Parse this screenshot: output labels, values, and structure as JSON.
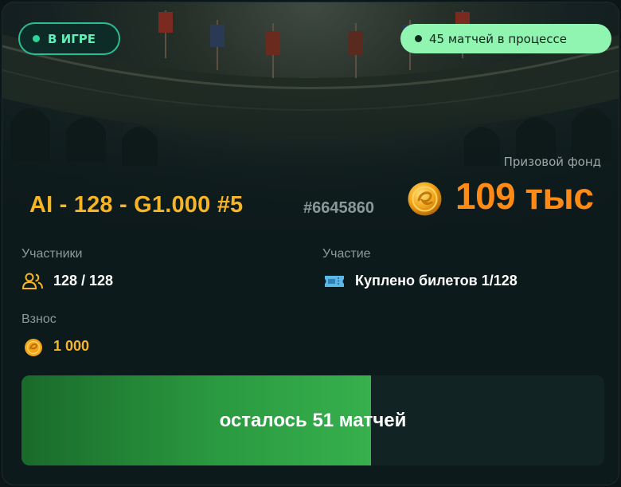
{
  "status": {
    "label": "В ИГРЕ"
  },
  "matches_badge": {
    "label": "45 матчей в процессе"
  },
  "tournament": {
    "title": "AI - 128 - G1.000 #5",
    "id": "#6645860"
  },
  "prize": {
    "label": "Призовой фонд",
    "value": "109 тыс"
  },
  "participants": {
    "label": "Участники",
    "value": "128 / 128"
  },
  "participation": {
    "label": "Участие",
    "value": "Куплено билетов 1/128"
  },
  "fee": {
    "label": "Взнос",
    "value": "1 000"
  },
  "progress": {
    "label": "осталось 51 матчей",
    "fraction": 0.6
  },
  "colors": {
    "accent_green": "#2bbd8f",
    "badge_green": "#8ff5b1",
    "gold": "#f5b526",
    "prize_orange": "#ff8a15"
  },
  "icons": {
    "status": "dot",
    "prize": "gold-coin-icon",
    "participants": "users-icon",
    "participation": "ticket-icon",
    "fee": "coin-icon"
  }
}
